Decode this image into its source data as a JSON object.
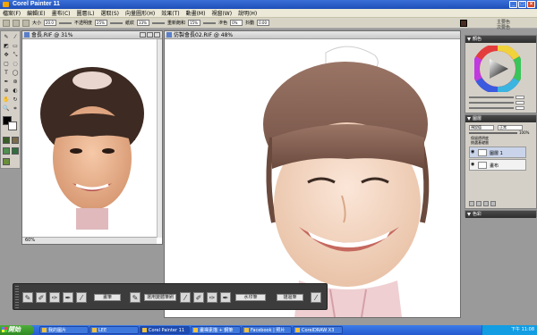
{
  "app": {
    "title": "Corel Painter 11"
  },
  "window_buttons": {
    "minimize": "_",
    "maximize": "□",
    "close": "×"
  },
  "menu": {
    "items": [
      "檔案(F)",
      "編輯(E)",
      "畫布(C)",
      "圖層(L)",
      "選取(S)",
      "向量圖形(H)",
      "效果(T)",
      "動畫(M)",
      "視窗(W)",
      "說明(H)"
    ]
  },
  "propbar": {
    "size_label": "大小",
    "size_value": "20.0",
    "opacity_label": "不透明度",
    "opacity_value": "25%",
    "grain_label": "紙紋",
    "grain_value": "33%",
    "resat_label": "重新飽和",
    "resat_value": "15%",
    "bleed_label": "滲色",
    "bleed_value": "0%",
    "jitter_label": "抖動",
    "jitter_value": "0.00"
  },
  "color_info": {
    "main_label": "主要色",
    "additional_label": "次要色"
  },
  "docs": {
    "photo_title": "會長.RIF @ 31%",
    "photo_status": "60%",
    "main_title": "仿製會長02.RIF @ 48%"
  },
  "panels": {
    "colors_title": "顏色",
    "layers_title": "圖層",
    "layers_blend": "預設值",
    "layers_mode": "正常",
    "layers_opacity": "100%",
    "layers_check1": "保留透明度",
    "layers_check2": "挑選基礎層",
    "layers": [
      {
        "name": "圖層 1",
        "selected": true
      },
      {
        "name": "畫布",
        "selected": false
      }
    ],
    "bottom_title": "色彩",
    "colors": {
      "wheel": "#e33c3c",
      "main": "#4a2e1f"
    }
  },
  "brushbar": {
    "labels": [
      "畫筆",
      "選用變體筆刷",
      "水印筆",
      "描邊筆"
    ]
  },
  "taskbar": {
    "start": "開始",
    "tasks": [
      "我的圖片",
      "LEE",
      "Corel Painter 11",
      "畫禪素描 + 鋼筆",
      "Facebook | 照片",
      "CorelDRAW X3"
    ],
    "clock": "下午 11:08"
  }
}
